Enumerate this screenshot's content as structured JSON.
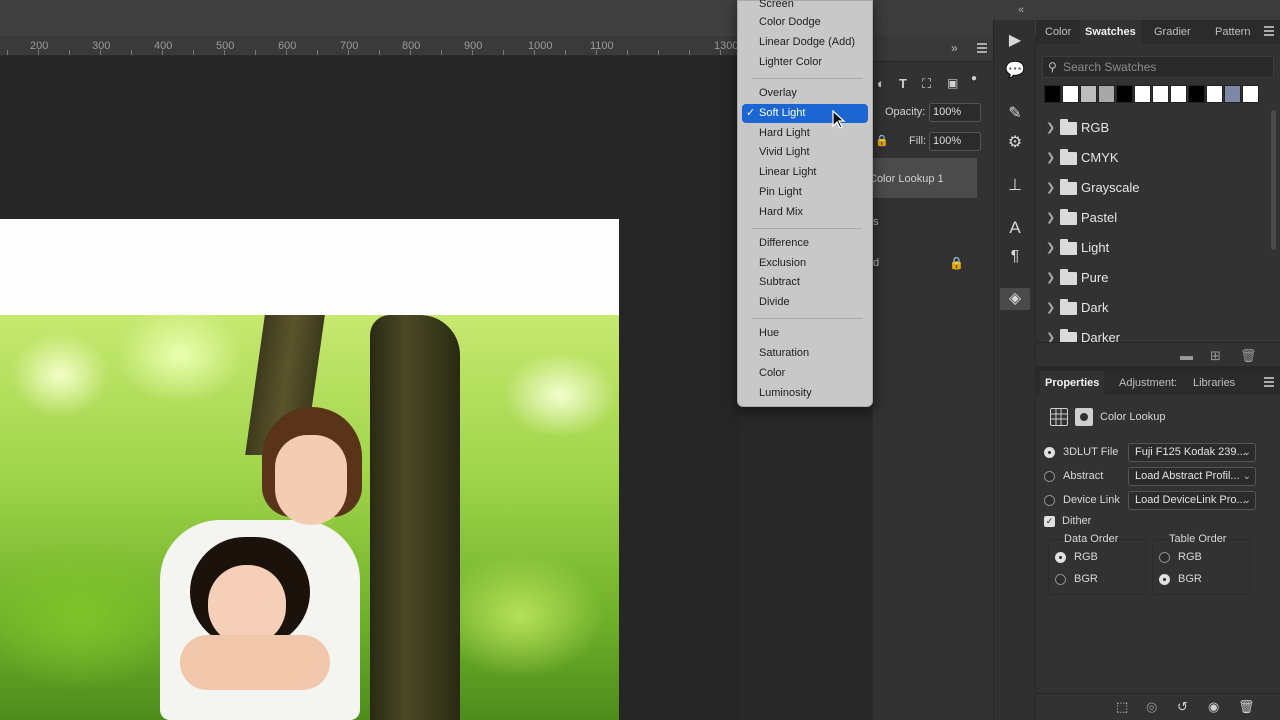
{
  "ruler": {
    "ticks": [
      "200",
      "300",
      "400",
      "500",
      "600",
      "700",
      "800",
      "900",
      "1000",
      "1100",
      "1300"
    ]
  },
  "blend_menu": {
    "groups": [
      [
        "Screen",
        "Color Dodge",
        "Linear Dodge (Add)",
        "Lighter Color"
      ],
      [
        "Overlay",
        "Soft Light",
        "Hard Light",
        "Vivid Light",
        "Linear Light",
        "Pin Light",
        "Hard Mix"
      ],
      [
        "Difference",
        "Exclusion",
        "Subtract",
        "Divide"
      ],
      [
        "Hue",
        "Saturation",
        "Color",
        "Luminosity"
      ]
    ],
    "selected": "Soft Light",
    "checkmark": "✓"
  },
  "layers": {
    "opacity_label": "Opacity:",
    "opacity_value": "100%",
    "fill_label": "Fill:",
    "fill_value": "100%",
    "layer1": "Color Lookup 1",
    "layer2_partial": "s",
    "layer3_partial": "d"
  },
  "swatches_panel": {
    "tabs": [
      "Color",
      "Swatches",
      "Gradier",
      "Pattern"
    ],
    "active_tab": "Swatches",
    "search_placeholder": "Search Swatches",
    "recent_colors": [
      "#000000",
      "#ffffff",
      "#bdbdbd",
      "#a8a8a8",
      "#000000",
      "#ffffff",
      "#ffffff",
      "#ffffff",
      "#000000",
      "#ffffff",
      "#7c88a6",
      "#ffffff"
    ],
    "groups": [
      "RGB",
      "CMYK",
      "Grayscale",
      "Pastel",
      "Light",
      "Pure",
      "Dark",
      "Darker"
    ]
  },
  "properties_panel": {
    "tabs": [
      "Properties",
      "Adjustment:",
      "Libraries"
    ],
    "active_tab": "Properties",
    "title": "Color Lookup",
    "rows": [
      {
        "label": "3DLUT File",
        "value": "Fuji F125 Kodak 239...",
        "selected": true
      },
      {
        "label": "Abstract",
        "value": "Load Abstract Profil...",
        "selected": false
      },
      {
        "label": "Device Link",
        "value": "Load DeviceLink Pro...",
        "selected": false
      }
    ],
    "dither_label": "Dither",
    "dither_checked": true,
    "data_order": {
      "title": "Data Order",
      "options": [
        "RGB",
        "BGR"
      ],
      "selected": "RGB"
    },
    "table_order": {
      "title": "Table Order",
      "options": [
        "RGB",
        "BGR"
      ],
      "selected": "BGR"
    }
  },
  "colors": {
    "accent": "#1b66d2",
    "panel": "#323232",
    "canvas": "#262626"
  }
}
